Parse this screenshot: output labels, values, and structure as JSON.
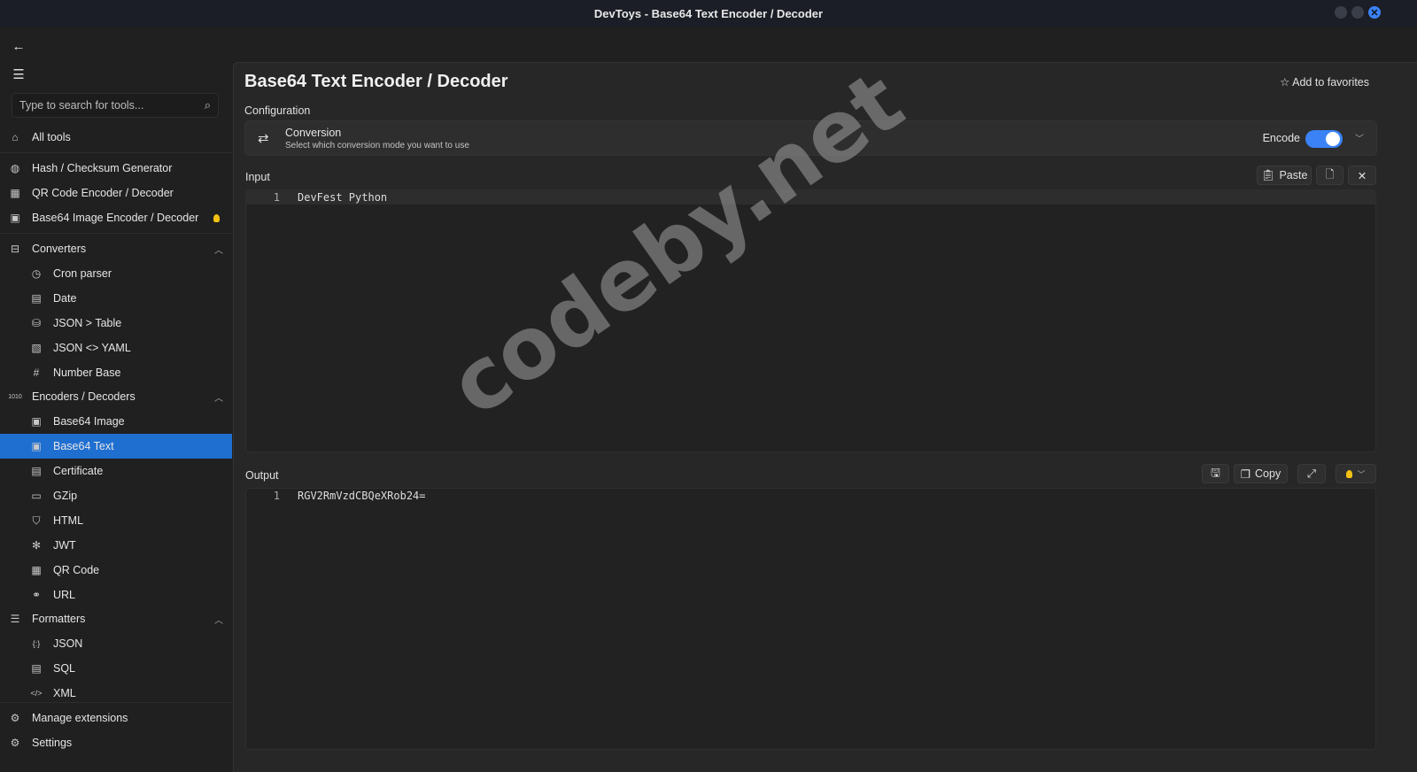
{
  "window": {
    "title": "DevToys - Base64 Text Encoder / Decoder"
  },
  "sidebar": {
    "search_placeholder": "Type to search for tools...",
    "all_tools": "All tools",
    "recent": [
      {
        "label": "Hash / Checksum Generator"
      },
      {
        "label": "QR Code Encoder / Decoder"
      },
      {
        "label": "Base64 Image Encoder / Decoder"
      }
    ],
    "groups": [
      {
        "label": "Converters",
        "items": [
          "Cron parser",
          "Date",
          "JSON > Table",
          "JSON <> YAML",
          "Number Base"
        ]
      },
      {
        "label": "Encoders / Decoders",
        "items": [
          "Base64 Image",
          "Base64 Text",
          "Certificate",
          "GZip",
          "HTML",
          "JWT",
          "QR Code",
          "URL"
        ]
      },
      {
        "label": "Formatters",
        "items": [
          "JSON",
          "SQL",
          "XML"
        ]
      }
    ],
    "selected": "Base64 Text",
    "manage_extensions": "Manage extensions",
    "settings": "Settings"
  },
  "main": {
    "title": "Base64 Text Encoder / Decoder",
    "add_to_favorites": "Add to favorites",
    "configuration_label": "Configuration",
    "conversion": {
      "title": "Conversion",
      "description": "Select which conversion mode you want to use",
      "mode_label": "Encode",
      "toggle_on": true
    },
    "input": {
      "label": "Input",
      "paste": "Paste",
      "lines": [
        {
          "n": "1",
          "text": "DevFest Python"
        }
      ]
    },
    "output": {
      "label": "Output",
      "copy": "Copy",
      "lines": [
        {
          "n": "1",
          "text": "RGV2RmVzdCBQeXRob24="
        }
      ]
    }
  },
  "watermark": "codeby.net",
  "colors": {
    "accent": "#1f6fd1",
    "toggle": "#3b82f6",
    "bulb": "#f5c211"
  }
}
